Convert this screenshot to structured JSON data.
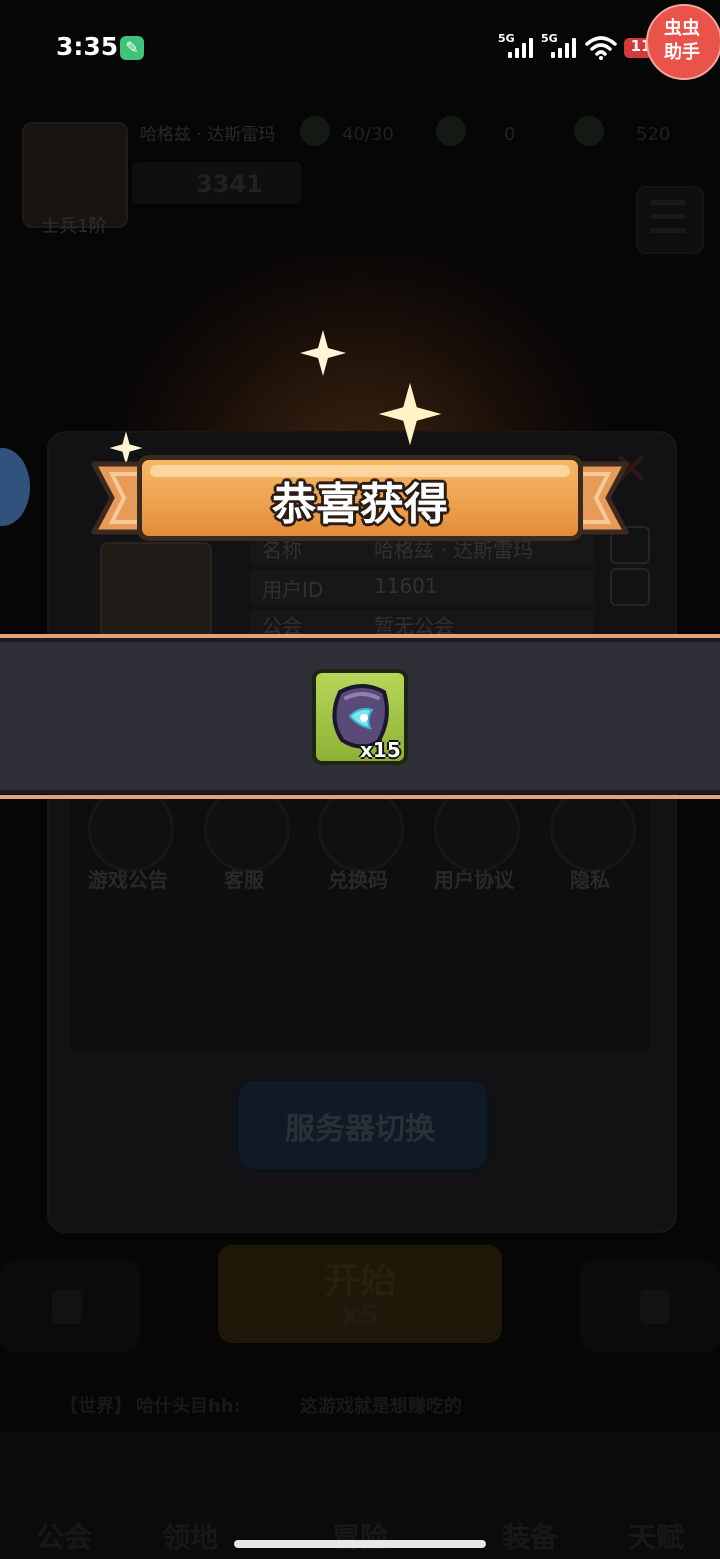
{
  "status_bar": {
    "time": "3:35",
    "signal1_label": "5G",
    "signal2_label": "5G",
    "battery": "11",
    "helper_line1": "虫虫",
    "helper_line2": "助手"
  },
  "background": {
    "header": {
      "avatar_label": "士兵1阶",
      "player_name": "哈格兹 · 达斯雷玛",
      "power": "3341",
      "resources": [
        "40/30",
        "0",
        "520"
      ]
    },
    "profile_panel": {
      "rows": [
        {
          "key": "名称",
          "value": "哈格兹 · 达斯雷玛"
        },
        {
          "key": "用户ID",
          "value": "11601"
        },
        {
          "key": "公会",
          "value": "暂无公会"
        }
      ],
      "actions": [
        {
          "label": "游戏公告",
          "icon": "notice-icon"
        },
        {
          "label": "客服",
          "icon": "chat-icon"
        },
        {
          "label": "兑换码",
          "icon": "gift-icon"
        },
        {
          "label": "用户协议",
          "icon": "agreement-icon"
        },
        {
          "label": "隐私",
          "icon": "lock-icon"
        }
      ],
      "server_switch": "服务器切换"
    },
    "start_button": {
      "label": "开始",
      "cost": "x5"
    },
    "chat": {
      "channel": "【世界】",
      "speaker": "哈什头目hh:",
      "message": "这游戏就是想赚吃的"
    },
    "tabs": [
      "公会",
      "领地",
      "冒险",
      "装备",
      "天赋"
    ]
  },
  "popup": {
    "title": "恭喜获得",
    "reward": {
      "icon": "crystal-shard-icon",
      "count": "x15"
    }
  },
  "colors": {
    "banner_orange": "#eea04c",
    "band_accent": "#e5a178",
    "item_green": "#a3c64a"
  }
}
